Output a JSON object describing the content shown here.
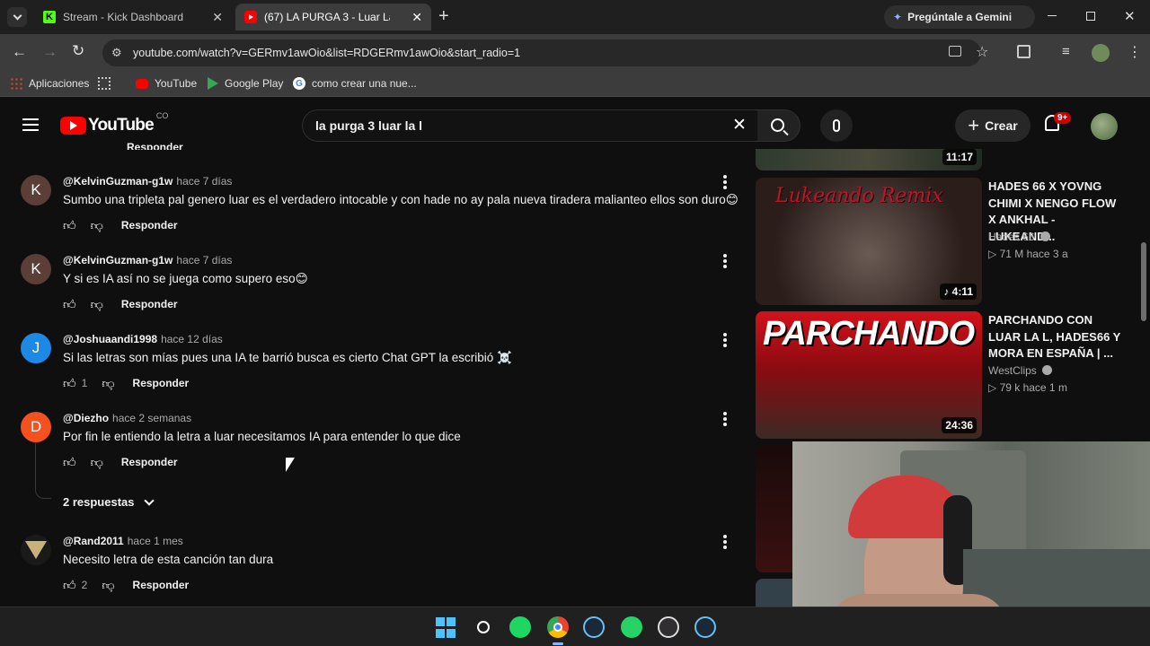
{
  "browser": {
    "tabs": [
      {
        "title": "Stream - Kick Dashboard",
        "active": false
      },
      {
        "title": "(67) LA PURGA 3 - Luar La L",
        "active": true
      }
    ],
    "new_tab": "+",
    "gemini_label": "Pregúntale a Gemini",
    "url": "youtube.com/watch?v=GERmv1awOio&list=RDGERmv1awOio&start_radio=1",
    "bookmarks": [
      "Aplicaciones",
      "YouTube",
      "Google Play",
      "como crear una nue..."
    ]
  },
  "youtube": {
    "logo_text": "YouTube",
    "region": "CO",
    "search_query": "la purga 3 luar la l",
    "create_label": "Crear",
    "notif_badge": "9+"
  },
  "comments": [
    {
      "user": "@KelvinGuzman-g1w",
      "date": "hace 7 días",
      "text": "Sumbo una tripleta pal genero luar es el verdadero intocable y con hade  no ay pala nueva  tiradera malianteo ellos son duro😊",
      "likes": "",
      "avatar_letter": "K",
      "avatar_color": "#5b3f36",
      "reply_label": "Responder"
    },
    {
      "user": "@KelvinGuzman-g1w",
      "date": "hace 7 días",
      "text": "Y si  es IA así no se juega  como supero eso😊",
      "likes": "",
      "avatar_letter": "K",
      "avatar_color": "#5b3f36",
      "reply_label": "Responder"
    },
    {
      "user": "@Joshuaandi1998",
      "date": "hace 12 días",
      "text": "Si las letras son mías pues una IA te barrió busca es cierto Chat GPT la escribió ☠️",
      "likes": "1",
      "avatar_letter": "J",
      "avatar_color": "#1e88e5",
      "reply_label": "Responder"
    },
    {
      "user": "@Diezho",
      "date": "hace 2 semanas",
      "text": "Por fin le entiendo la letra a luar necesitamos IA para entender lo que dice",
      "likes": "",
      "avatar_letter": "D",
      "avatar_color": "#f4511e",
      "reply_label": "Responder"
    },
    {
      "user": "@Rand2011",
      "date": "hace 1 mes",
      "text": "Necesito letra de esta canción tan dura",
      "likes": "2",
      "avatar_letter": "",
      "avatar_color": "#1a1a1a",
      "reply_label": "Responder"
    }
  ],
  "replies_toggle": "2 respuestas",
  "partial_top_reply_label": "Responder",
  "videos": [
    {
      "duration": "11:17"
    },
    {
      "title": "HADES 66 X YOVNG CHIMI X NENGO FLOW X ANKHAL - LUKEAND...",
      "channel": "Hades 66",
      "stats": "71 M  hace 3 a",
      "duration": "4:11",
      "thumb_text": "Lukeando Remix"
    },
    {
      "title": "PARCHANDO CON LUAR LA L, HADES66 Y MORA EN ESPAÑA | ...",
      "channel": "WestClips",
      "stats": "79 k  hace 1 m",
      "duration": "24:36",
      "thumb_text": "PARCHANDO"
    }
  ],
  "colors": {
    "yt_red": "#ff0000",
    "bg": "#0f0f0f",
    "chrome_dark": "#1f1f1f",
    "chrome_toolbar": "#3c3c3c"
  }
}
